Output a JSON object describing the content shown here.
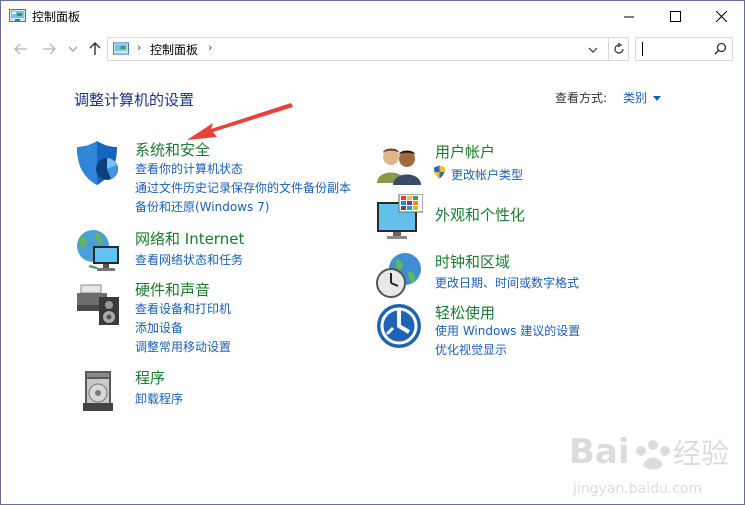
{
  "window": {
    "title": "控制面板"
  },
  "address": {
    "crumb": "控制面板",
    "sep": "›"
  },
  "content": {
    "heading": "调整计算机的设置",
    "view_by_label": "查看方式:",
    "view_by_value": "类别"
  },
  "categories": [
    {
      "title": "系统和安全",
      "links": [
        "查看你的计算机状态",
        "通过文件历史记录保存你的文件备份副本",
        "备份和还原(Windows 7)"
      ]
    },
    {
      "title": "网络和 Internet",
      "links": [
        "查看网络状态和任务"
      ]
    },
    {
      "title": "硬件和声音",
      "links": [
        "查看设备和打印机",
        "添加设备",
        "调整常用移动设置"
      ]
    },
    {
      "title": "程序",
      "links": [
        "卸载程序"
      ]
    },
    {
      "title": "用户帐户",
      "links": [
        "更改帐户类型"
      ]
    },
    {
      "title": "外观和个性化",
      "links": []
    },
    {
      "title": "时钟和区域",
      "links": [
        "更改日期、时间或数字格式"
      ]
    },
    {
      "title": "轻松使用",
      "links": [
        "使用 Windows 建议的设置",
        "优化视觉显示"
      ]
    }
  ],
  "watermark": {
    "text": "Bai 经验",
    "url": "jingyan.baidu.com"
  },
  "colors": {
    "link": "#1a5fb4",
    "category": "#1b7a2e",
    "heading": "#1e3287",
    "annotation": "#e8413a"
  }
}
